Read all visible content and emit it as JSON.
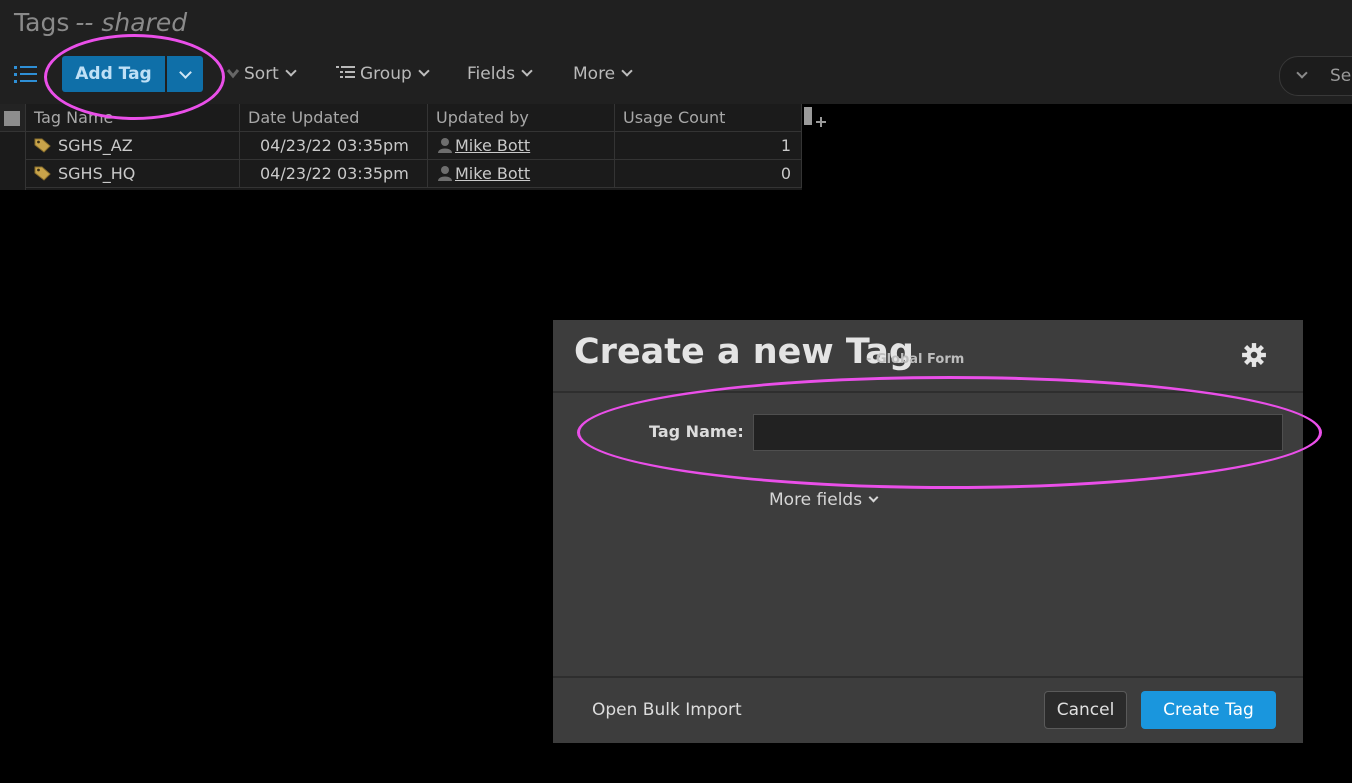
{
  "page": {
    "title": "Tags",
    "title_separator": "--",
    "title_scope": "shared"
  },
  "toolbar": {
    "add_label": "Add Tag",
    "sort_label": "Sort",
    "group_label": "Group",
    "fields_label": "Fields",
    "more_label": "More",
    "search_placeholder": "Sea"
  },
  "grid": {
    "columns": [
      "Tag Name",
      "Date Updated",
      "Updated by",
      "Usage Count"
    ],
    "rows": [
      {
        "name": "SGHS_AZ",
        "date": "04/23/22 03:35pm",
        "by": "Mike Bott",
        "count": "1"
      },
      {
        "name": "SGHS_HQ",
        "date": "04/23/22 03:35pm",
        "by": "Mike Bott",
        "count": "0"
      }
    ]
  },
  "dialog": {
    "title": "Create a new Tag",
    "subtitle": "- Global Form",
    "field_label": "Tag Name:",
    "field_value": "",
    "more_fields": "More fields",
    "bulk_import": "Open Bulk Import",
    "cancel": "Cancel",
    "create": "Create Tag"
  },
  "colors": {
    "accent": "#1a96dd",
    "primary_button": "#0f6fa8",
    "highlight_annotation": "#ea4fe9",
    "tag_icon": "#c9a44a"
  },
  "icons": [
    "list-icon",
    "chevron-down-icon",
    "sort-icon",
    "group-icon",
    "tag-icon",
    "user-icon",
    "gear-icon",
    "add-column-icon"
  ]
}
